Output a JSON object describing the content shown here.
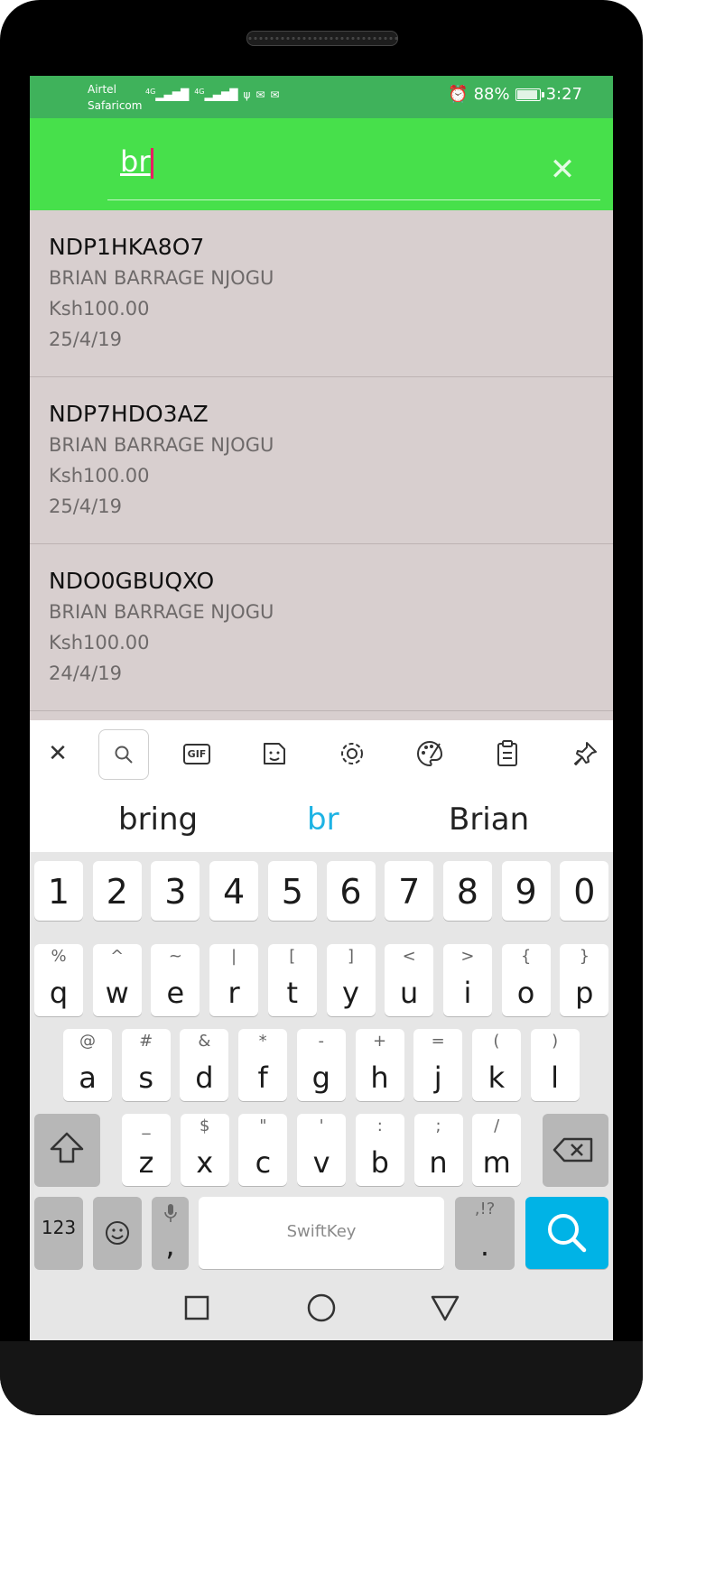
{
  "status": {
    "carrier_top": "Airtel",
    "carrier_bottom": "Safaricom",
    "net1": "4G",
    "net2": "4G",
    "battery": "88%",
    "battery_level": 0.88,
    "time": "3:27"
  },
  "search": {
    "value": "br"
  },
  "results": [
    {
      "code": "NDP1HKA8O7",
      "name": "BRIAN BARRAGE NJOGU",
      "amount": "Ksh100.00",
      "date": "25/4/19"
    },
    {
      "code": "NDP7HDO3AZ",
      "name": "BRIAN BARRAGE NJOGU",
      "amount": "Ksh100.00",
      "date": "25/4/19"
    },
    {
      "code": "NDO0GBUQXO",
      "name": "BRIAN BARRAGE NJOGU",
      "amount": "Ksh100.00",
      "date": "24/4/19"
    }
  ],
  "keyboard": {
    "toolbar": {
      "gif": "GIF"
    },
    "suggestions": [
      "bring",
      "br",
      "Brian"
    ],
    "numbers": [
      "1",
      "2",
      "3",
      "4",
      "5",
      "6",
      "7",
      "8",
      "9",
      "0"
    ],
    "row1": [
      {
        "k": "q",
        "a": "%"
      },
      {
        "k": "w",
        "a": "^"
      },
      {
        "k": "e",
        "a": "~"
      },
      {
        "k": "r",
        "a": "|"
      },
      {
        "k": "t",
        "a": "["
      },
      {
        "k": "y",
        "a": "]"
      },
      {
        "k": "u",
        "a": "<"
      },
      {
        "k": "i",
        "a": ">"
      },
      {
        "k": "o",
        "a": "{"
      },
      {
        "k": "p",
        "a": "}"
      }
    ],
    "row2": [
      {
        "k": "a",
        "a": "@"
      },
      {
        "k": "s",
        "a": "#"
      },
      {
        "k": "d",
        "a": "&"
      },
      {
        "k": "f",
        "a": "*"
      },
      {
        "k": "g",
        "a": "-"
      },
      {
        "k": "h",
        "a": "+"
      },
      {
        "k": "j",
        "a": "="
      },
      {
        "k": "k",
        "a": "("
      },
      {
        "k": "l",
        "a": ")"
      }
    ],
    "row3": [
      {
        "k": "z",
        "a": "_"
      },
      {
        "k": "x",
        "a": "$"
      },
      {
        "k": "c",
        "a": "\""
      },
      {
        "k": "v",
        "a": "'"
      },
      {
        "k": "b",
        "a": ":"
      },
      {
        "k": "n",
        "a": ";"
      },
      {
        "k": "m",
        "a": "/"
      }
    ],
    "symbols_label": "123",
    "comma": ",",
    "space_label": "SwiftKey",
    "period": ".",
    "period_alt": ",!?"
  }
}
